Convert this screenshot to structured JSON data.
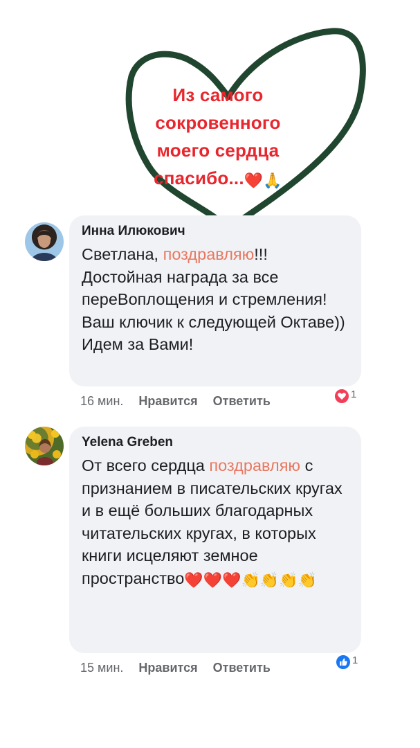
{
  "caption": {
    "lines": [
      "Из самого",
      "сокровенного",
      "моего сердца",
      "спасибо..."
    ],
    "emojis": [
      "❤️",
      "🙏"
    ],
    "heart_color": "#21462f",
    "text_color": "#e8262e"
  },
  "comments": [
    {
      "author": "Инна Илюкович",
      "text_before": "Светлана, ",
      "highlight": "поздравляю",
      "text_after": "!!! Достойная награда за все переВоплощения и стремления! Ваш ключик к следующей Октаве))  Идем за Вами!",
      "time": "16 мин.",
      "like_label": "Нравится",
      "reply_label": "Ответить",
      "reaction": "heart-reaction",
      "reaction_count": "1"
    },
    {
      "author": "Yelena Greben",
      "text_before": "От всего сердца ",
      "highlight": "поздравляю",
      "text_after": " с признанием в писательских кругах и в ещё больших благодарных читательских кругах, в которых книги исцеляют земное пространство",
      "emojis": "❤️❤️❤️👏👏👏👏",
      "time": "15 мин.",
      "like_label": "Нравится",
      "reply_label": "Ответить",
      "reaction": "like-reaction",
      "reaction_count": "1"
    }
  ]
}
